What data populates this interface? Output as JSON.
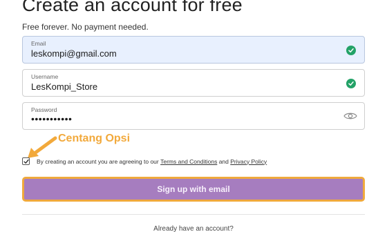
{
  "page": {
    "title": "Create an account for free",
    "subtitle": "Free forever. No payment needed."
  },
  "form": {
    "email": {
      "label": "Email",
      "value": "leskompi@gmail.com",
      "valid": true
    },
    "username": {
      "label": "Username",
      "value": "LesKompi_Store",
      "valid": true
    },
    "password": {
      "label": "Password",
      "value": "•••••••••••"
    }
  },
  "annotation": {
    "text": "Centang Opsi",
    "color": "#f2a93b"
  },
  "consent": {
    "checked": true,
    "prefix": "By creating an account you are agreeing to our",
    "terms_link": "Terms and Conditions",
    "and": "and",
    "privacy_link": "Privacy Policy"
  },
  "signup_button": {
    "label": "Sign up with email",
    "color": "#a67dbf",
    "highlight": "#f0a93c"
  },
  "footer": {
    "already_text": "Already have an account?"
  },
  "icons": {
    "valid": "check-circle-icon",
    "reveal": "eye-icon",
    "pointer": "arrow-icon"
  }
}
